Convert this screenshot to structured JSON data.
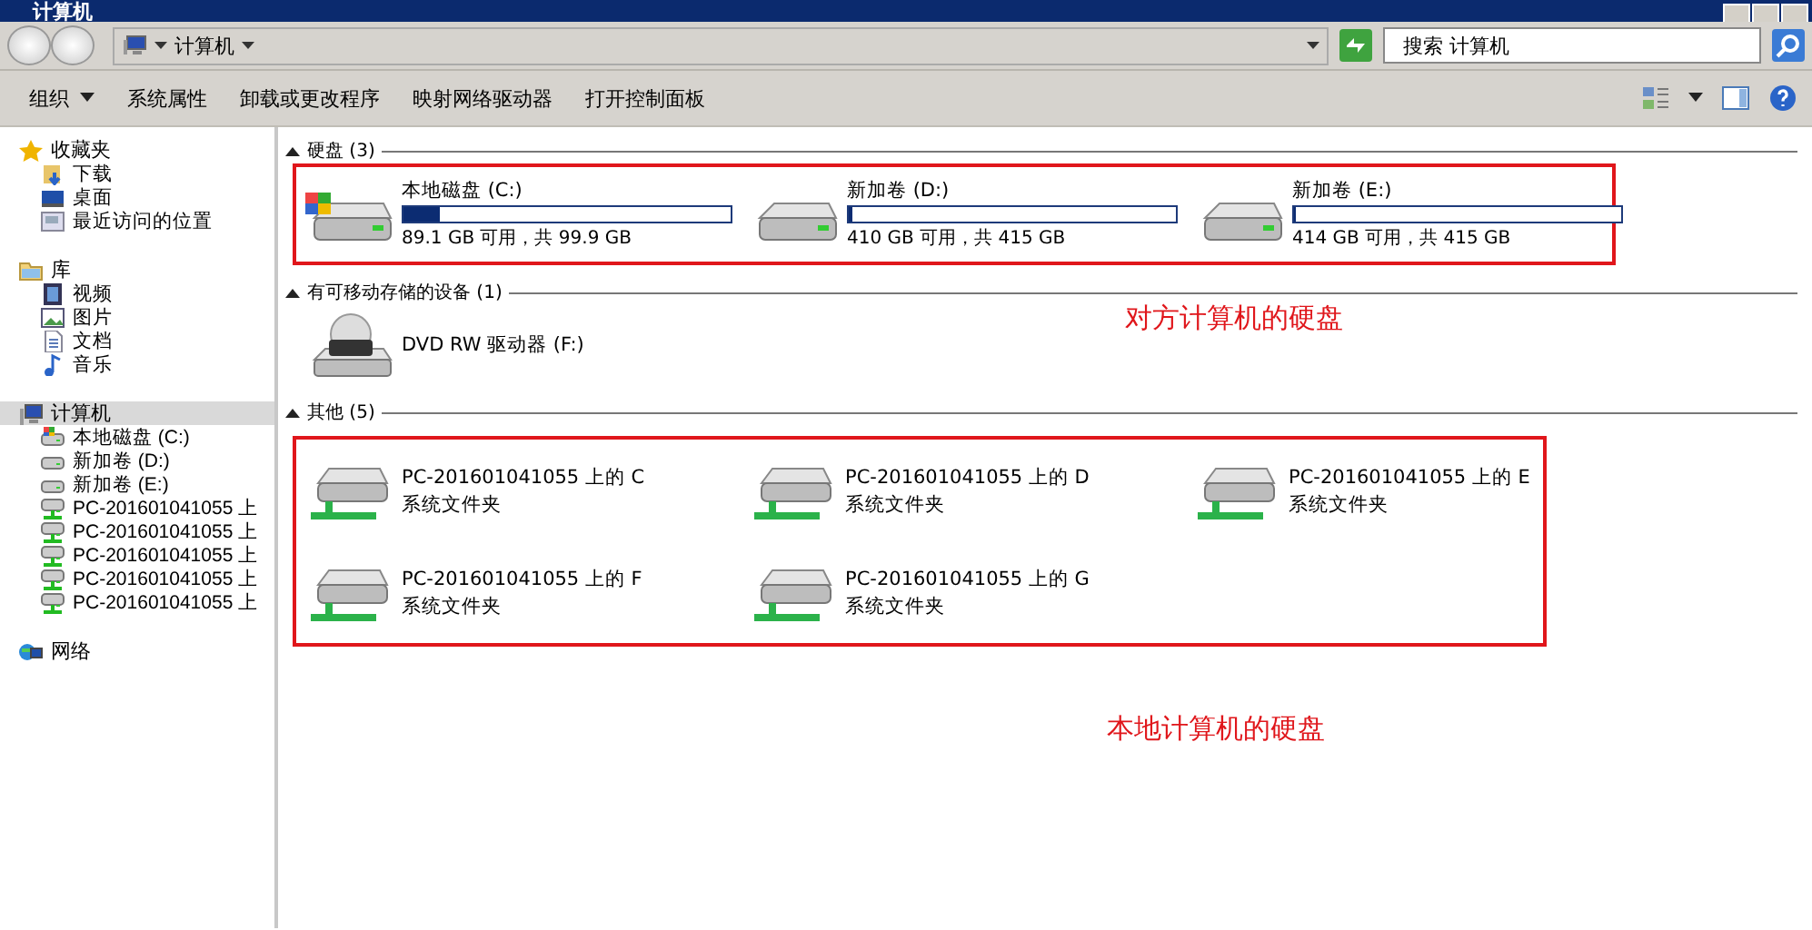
{
  "window": {
    "title": "计算机"
  },
  "address_bar": {
    "path": "计算机",
    "search": {
      "placeholder": "搜索 计算机"
    }
  },
  "toolbar": {
    "items": [
      {
        "label": "组织",
        "dropdown": true
      },
      {
        "label": "系统属性",
        "dropdown": false
      },
      {
        "label": "卸载或更改程序",
        "dropdown": false
      },
      {
        "label": "映射网络驱动器",
        "dropdown": false
      },
      {
        "label": "打开控制面板",
        "dropdown": false
      }
    ]
  },
  "sidebar": {
    "items": [
      {
        "label": "收藏夹",
        "kind": "star",
        "selected": false,
        "children": [
          {
            "label": "下载",
            "kind": "download",
            "selected": false
          },
          {
            "label": "桌面",
            "kind": "desktop",
            "selected": false
          },
          {
            "label": "最近访问的位置",
            "kind": "recent",
            "selected": false
          }
        ]
      },
      {
        "label": "库",
        "kind": "library",
        "selected": false,
        "children": [
          {
            "label": "视频",
            "kind": "video",
            "selected": false
          },
          {
            "label": "图片",
            "kind": "image",
            "selected": false
          },
          {
            "label": "文档",
            "kind": "document",
            "selected": false
          },
          {
            "label": "音乐",
            "kind": "music",
            "selected": false
          }
        ]
      },
      {
        "label": "计算机",
        "kind": "computer",
        "selected": true,
        "children": [
          {
            "label": "本地磁盘 (C:)",
            "kind": "system-drive",
            "selected": false
          },
          {
            "label": "新加卷 (D:)",
            "kind": "drive",
            "selected": false
          },
          {
            "label": "新加卷 (E:)",
            "kind": "drive",
            "selected": false
          },
          {
            "label": "PC-201601041055 上",
            "kind": "network-drive",
            "selected": false
          },
          {
            "label": "PC-201601041055 上",
            "kind": "network-drive",
            "selected": false
          },
          {
            "label": "PC-201601041055 上",
            "kind": "network-drive",
            "selected": false
          },
          {
            "label": "PC-201601041055 上",
            "kind": "network-drive",
            "selected": false
          },
          {
            "label": "PC-201601041055 上",
            "kind": "network-drive",
            "selected": false
          }
        ]
      },
      {
        "label": "网络",
        "kind": "network",
        "selected": false
      }
    ]
  },
  "groups": [
    {
      "title": "硬盘 (3)",
      "expanded": true,
      "highlighted": true,
      "items": [
        {
          "kind": "drive",
          "system": true,
          "name": "本地磁盘 (C:)",
          "level": 0.11,
          "reading": "89.1 GB 可用，共 99.9 GB"
        },
        {
          "kind": "drive",
          "system": false,
          "name": "新加卷 (D:)",
          "level": 0.012,
          "reading": "410 GB 可用，共 415 GB"
        },
        {
          "kind": "drive",
          "system": false,
          "name": "新加卷 (E:)",
          "level": 0.003,
          "reading": "414 GB 可用，共 415 GB"
        }
      ]
    },
    {
      "title": "有可移动存储的设备 (1)",
      "expanded": true,
      "highlighted": false,
      "items": [
        {
          "kind": "dvd",
          "name": "DVD RW 驱动器 (F:)"
        }
      ]
    },
    {
      "title": "其他 (5)",
      "expanded": true,
      "highlighted": true,
      "items": [
        {
          "kind": "network",
          "name": "PC-201601041055 上的 C",
          "description": "系统文件夹"
        },
        {
          "kind": "network",
          "name": "PC-201601041055 上的 D",
          "description": "系统文件夹"
        },
        {
          "kind": "network",
          "name": "PC-201601041055 上的 E",
          "description": "系统文件夹"
        },
        {
          "kind": "network",
          "name": "PC-201601041055 上的 F",
          "description": "系统文件夹"
        },
        {
          "kind": "network",
          "name": "PC-201601041055 上的 G",
          "description": "系统文件夹"
        }
      ]
    }
  ],
  "annotations": [
    {
      "text": "对方计算机的硬盘"
    },
    {
      "text": "本地计算机的硬盘"
    }
  ]
}
